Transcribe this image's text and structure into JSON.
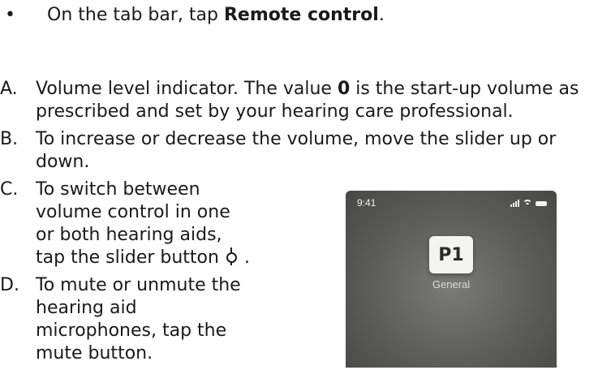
{
  "intro": {
    "bullet": "•",
    "text_before": "On the tab bar, tap ",
    "text_bold": "Remote control",
    "text_after": "."
  },
  "steps": [
    {
      "letter": "A.",
      "text_before": "Volume level indicator. The value ",
      "text_bold": "0",
      "text_after": " is the start-up volume as prescribed and set by your hearing care professional."
    },
    {
      "letter": "B.",
      "text": "To increase or decrease the volume, move the slider up or down."
    },
    {
      "letter": "C.",
      "text_before": "To switch between volume control in one or both hearing aids, tap the slider button",
      "icon": "slider-button-icon",
      "text_after": "."
    },
    {
      "letter": "D.",
      "text": "To mute or unmute the hearing aid microphones, tap the mute button."
    }
  ],
  "phone": {
    "status_time": "9:41",
    "program_code": "P1",
    "program_name": "General"
  }
}
